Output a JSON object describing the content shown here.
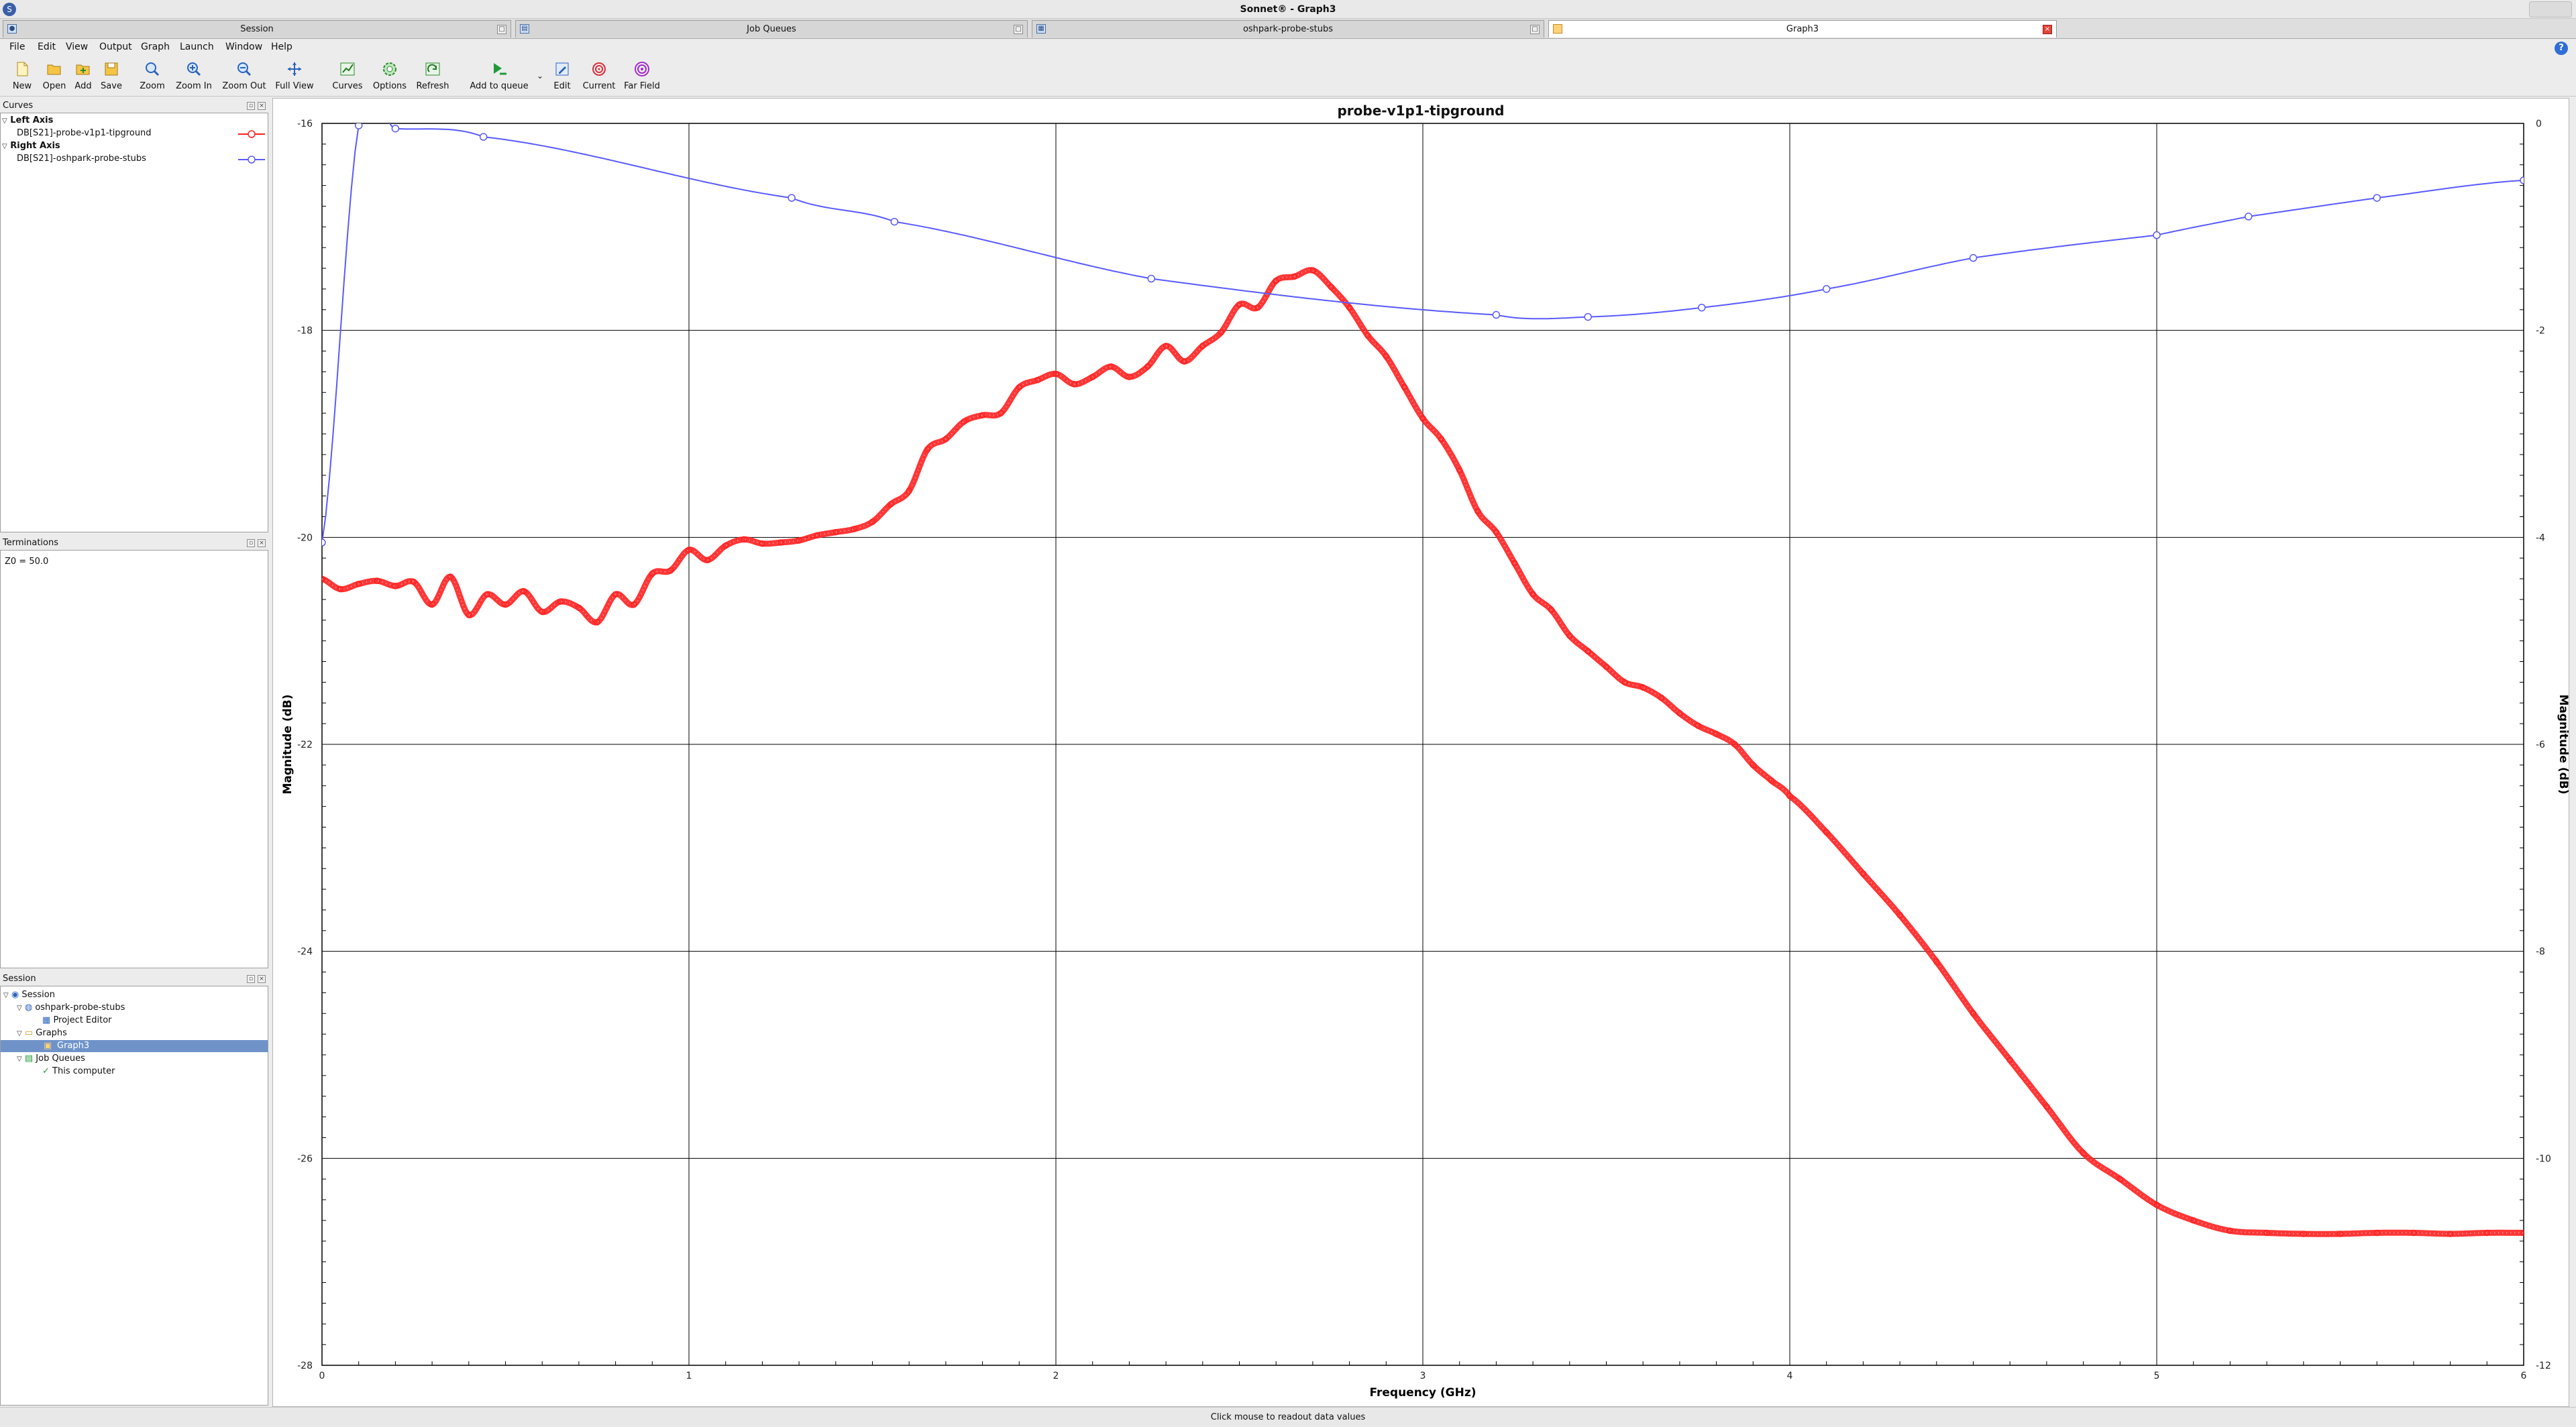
{
  "window": {
    "title": "Sonnet® - Graph3"
  },
  "tabs": [
    {
      "label": "Session"
    },
    {
      "label": "Job Queues"
    },
    {
      "label": "oshpark-probe-stubs"
    },
    {
      "label": "Graph3"
    }
  ],
  "menu": [
    "File",
    "Edit",
    "View",
    "Output",
    "Graph",
    "Launch",
    "Window",
    "Help"
  ],
  "toolbar": [
    "New",
    "Open",
    "Add",
    "Save",
    "Zoom",
    "Zoom In",
    "Zoom Out",
    "Full View",
    "Curves",
    "Options",
    "Refresh",
    "Add to queue",
    "Edit",
    "Current",
    "Far Field"
  ],
  "curves_panel": {
    "title": "Curves",
    "left_axis": "Left Axis",
    "left_curve": "DB[S21]-probe-v1p1-tipground",
    "right_axis": "Right Axis",
    "right_curve": "DB[S21]-oshpark-probe-stubs"
  },
  "terminations_panel": {
    "title": "Terminations",
    "z0": "Z0 = 50.0"
  },
  "session_panel": {
    "title": "Session",
    "items": [
      "Session",
      "oshpark-probe-stubs",
      "Project Editor",
      "Graphs",
      "Graph3",
      "Job Queues",
      "This computer"
    ]
  },
  "status": "Click mouse to readout data values",
  "colors": {
    "left_curve": "#ff2020",
    "right_curve": "#5a5aff",
    "selection": "#6f93c9"
  },
  "chart_data": {
    "type": "line",
    "title": "probe-v1p1-tipground",
    "xlabel": "Frequency (GHz)",
    "ylabel_left": "Magnitude (dB)",
    "ylabel_right": "Magnitude (dB)",
    "xlim": [
      0,
      6
    ],
    "ylim_left": [
      -28,
      -16
    ],
    "ylim_right": [
      -12,
      0
    ],
    "x_ticks": [
      "0",
      "1",
      "2",
      "3",
      "4",
      "5",
      "6"
    ],
    "y_ticks_left": [
      "-16",
      "-18",
      "-20",
      "-22",
      "-24",
      "-26",
      "-28"
    ],
    "y_ticks_right": [
      "0",
      "-2",
      "-4",
      "-6",
      "-8",
      "-10",
      "-12"
    ],
    "grid": true,
    "series": [
      {
        "name": "DB[S21]-probe-v1p1-tipground",
        "axis": "left",
        "color": "#ff2020",
        "x": [
          0,
          0.05,
          0.1,
          0.15,
          0.2,
          0.25,
          0.3,
          0.35,
          0.4,
          0.45,
          0.5,
          0.55,
          0.6,
          0.65,
          0.7,
          0.75,
          0.8,
          0.85,
          0.9,
          0.95,
          1.0,
          1.05,
          1.1,
          1.15,
          1.2,
          1.25,
          1.3,
          1.35,
          1.4,
          1.45,
          1.5,
          1.55,
          1.6,
          1.65,
          1.7,
          1.75,
          1.8,
          1.85,
          1.9,
          1.95,
          2.0,
          2.05,
          2.1,
          2.15,
          2.2,
          2.25,
          2.3,
          2.35,
          2.4,
          2.45,
          2.5,
          2.55,
          2.6,
          2.65,
          2.7,
          2.75,
          2.8,
          2.85,
          2.9,
          2.95,
          3.0,
          3.05,
          3.1,
          3.15,
          3.2,
          3.25,
          3.3,
          3.35,
          3.4,
          3.45,
          3.5,
          3.55,
          3.6,
          3.65,
          3.7,
          3.75,
          3.8,
          3.85,
          3.9,
          3.95,
          4.0,
          4.1,
          4.2,
          4.3,
          4.4,
          4.5,
          4.6,
          4.7,
          4.8,
          4.9,
          5.0,
          5.1,
          5.2,
          5.3,
          5.4,
          5.5,
          5.6,
          5.7,
          5.8,
          5.9,
          6.0
        ],
        "y": [
          -20.4,
          -20.5,
          -20.45,
          -20.42,
          -20.47,
          -20.43,
          -20.65,
          -20.38,
          -20.75,
          -20.55,
          -20.65,
          -20.52,
          -20.72,
          -20.62,
          -20.68,
          -20.82,
          -20.55,
          -20.65,
          -20.35,
          -20.32,
          -20.12,
          -20.22,
          -20.08,
          -20.02,
          -20.06,
          -20.05,
          -20.03,
          -19.98,
          -19.95,
          -19.92,
          -19.85,
          -19.68,
          -19.55,
          -19.15,
          -19.05,
          -18.88,
          -18.82,
          -18.8,
          -18.55,
          -18.48,
          -18.42,
          -18.52,
          -18.45,
          -18.35,
          -18.45,
          -18.35,
          -18.15,
          -18.3,
          -18.15,
          -18.02,
          -17.75,
          -17.78,
          -17.52,
          -17.48,
          -17.42,
          -17.58,
          -17.78,
          -18.05,
          -18.25,
          -18.55,
          -18.85,
          -19.05,
          -19.35,
          -19.75,
          -19.95,
          -20.25,
          -20.55,
          -20.7,
          -20.95,
          -21.1,
          -21.25,
          -21.4,
          -21.45,
          -21.55,
          -21.7,
          -21.82,
          -21.9,
          -22.0,
          -22.2,
          -22.35,
          -22.5,
          -22.85,
          -23.25,
          -23.65,
          -24.1,
          -24.6,
          -25.05,
          -25.5,
          -25.95,
          -26.2,
          -26.45,
          -26.6,
          -26.7,
          -26.72,
          -26.73,
          -26.73,
          -26.72,
          -26.72,
          -26.73,
          -26.72,
          -26.72
        ]
      },
      {
        "name": "DB[S21]-oshpark-probe-stubs",
        "axis": "right",
        "color": "#5a5aff",
        "x": [
          0,
          0.1,
          0.2,
          0.44,
          1.28,
          1.56,
          2.26,
          3.2,
          3.45,
          3.76,
          4.1,
          4.5,
          5.0,
          5.25,
          5.6,
          6.0
        ],
        "y": [
          -4.05,
          -0.02,
          -0.05,
          -0.13,
          -0.72,
          -0.95,
          -1.5,
          -1.85,
          -1.87,
          -1.78,
          -1.6,
          -1.3,
          -1.08,
          -0.9,
          -0.72,
          -0.55
        ]
      }
    ]
  }
}
